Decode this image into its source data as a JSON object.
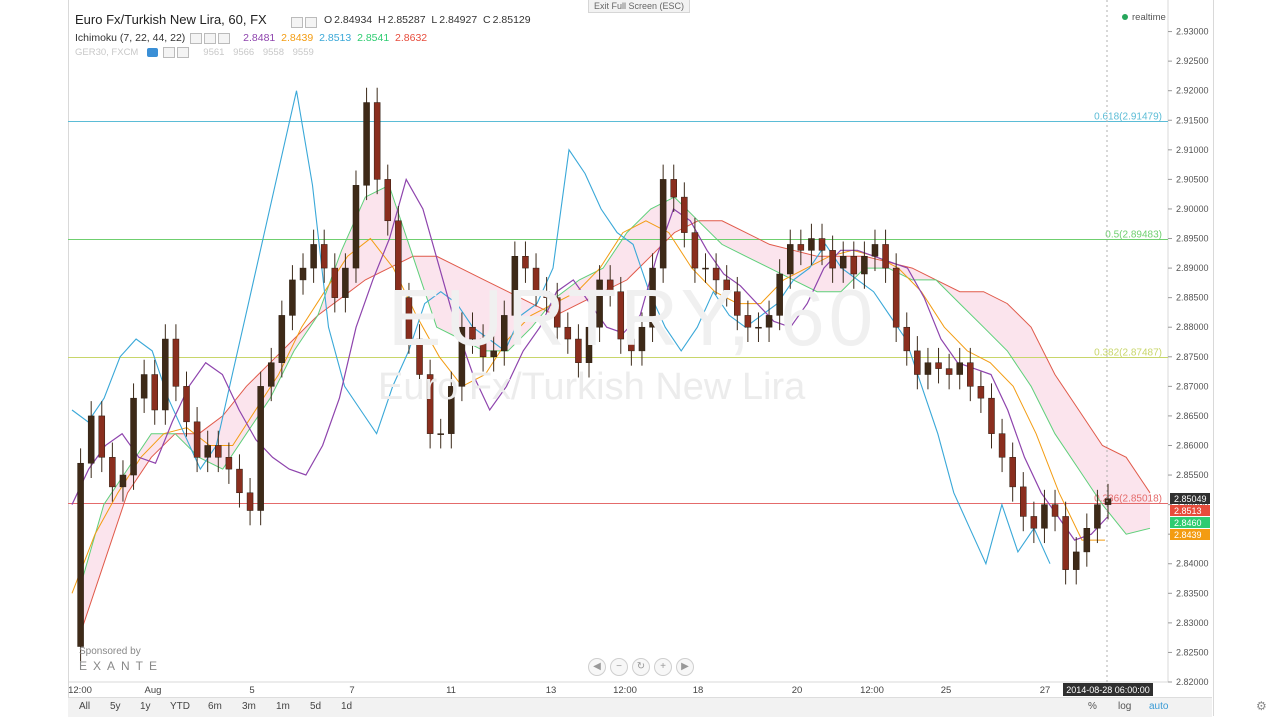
{
  "window": {
    "exit_fullscreen": "Exit Full Screen (ESC)",
    "realtime": "realtime"
  },
  "legend": {
    "symbol_title": "Euro Fx/Turkish New Lira, 60, FX",
    "ohlc": {
      "o_label": "O",
      "o": "2.84934",
      "h_label": "H",
      "h": "2.85287",
      "l_label": "L",
      "l": "2.84927",
      "c_label": "C",
      "c": "2.85129"
    },
    "ichimoku": {
      "label": "Ichimoku (7, 22, 44, 22)",
      "values": [
        "2.8481",
        "2.8439",
        "2.8513",
        "2.8541",
        "2.8632"
      ],
      "colors": [
        "#8e44ad",
        "#f39c12",
        "#3aa8d8",
        "#2ecc71",
        "#e74c3c"
      ]
    },
    "compare": {
      "label": "GER30, FXCM",
      "values": [
        "9561",
        "9566",
        "9558",
        "9559"
      ]
    }
  },
  "watermark": {
    "symbol": "EURTRY, 60",
    "description": "Euro Fx/Turkish New Lira"
  },
  "sponsor": {
    "label": "Sponsored by",
    "brand": "EXANTE"
  },
  "bottom": {
    "ranges": [
      "All",
      "5y",
      "1y",
      "YTD",
      "6m",
      "3m",
      "1m",
      "5d",
      "1d"
    ],
    "percent": "%",
    "log": "log",
    "auto": "auto"
  },
  "colors": {
    "tenkan": "#8e44ad",
    "kijun": "#f39c12",
    "chikou": "#3aa8d8",
    "span_a": "#5ed07a",
    "span_b": "#e05a4a",
    "cloud": "#f9d9e6",
    "candle_up": "#5a3a1a",
    "candle_down": "#7a2a1a"
  },
  "chart_data": {
    "type": "candlestick",
    "title": "Euro Fx/Turkish New Lira, 60, FX",
    "ylim": [
      2.82,
      2.935
    ],
    "y_ticks": [
      "2.93000",
      "2.92500",
      "2.92000",
      "2.91500",
      "2.91000",
      "2.90500",
      "2.90000",
      "2.89500",
      "2.89000",
      "2.88500",
      "2.88000",
      "2.87500",
      "2.87000",
      "2.86500",
      "2.86000",
      "2.85500",
      "2.85000",
      "2.84500",
      "2.84000",
      "2.83500",
      "2.83000",
      "2.82500",
      "2.82000"
    ],
    "x_tick_labels": [
      "12:00",
      "Aug",
      "5",
      "7",
      "11",
      "13",
      "12:00",
      "18",
      "20",
      "12:00",
      "25",
      "27",
      "2014-08-28 06:00:00"
    ],
    "fib_levels": [
      {
        "label": "0.618(2.91479)",
        "value": 2.91479,
        "color": "#5bbcd6"
      },
      {
        "label": "0.5(2.89483)",
        "value": 2.89483,
        "color": "#6fcf6f"
      },
      {
        "label": "0.382(2.87487)",
        "value": 2.87487,
        "color": "#c8d66a"
      },
      {
        "label": "0.236(2.85018)",
        "value": 2.85018,
        "color": "#e46b6b"
      }
    ],
    "price_labels": [
      {
        "value": "2.85049",
        "color": "#2f2f2f"
      },
      {
        "value": "2.8513",
        "color": "#e74c3c"
      },
      {
        "value": "2.8460",
        "color": "#2ecc71"
      },
      {
        "value": "2.8439",
        "color": "#f39c12"
      }
    ],
    "close_series": [
      2.826,
      2.857,
      2.865,
      2.858,
      2.853,
      2.855,
      2.868,
      2.872,
      2.866,
      2.878,
      2.87,
      2.864,
      2.858,
      2.86,
      2.858,
      2.856,
      2.852,
      2.849,
      2.87,
      2.874,
      2.882,
      2.888,
      2.89,
      2.894,
      2.89,
      2.885,
      2.89,
      2.904,
      2.918,
      2.905,
      2.898,
      2.885,
      2.878,
      2.872,
      2.862,
      2.862,
      2.87,
      2.88,
      2.878,
      2.875,
      2.876,
      2.882,
      2.892,
      2.89,
      2.886,
      2.885,
      2.88,
      2.878,
      2.874,
      2.88,
      2.888,
      2.886,
      2.878,
      2.876,
      2.88,
      2.89,
      2.905,
      2.902,
      2.896,
      2.89,
      2.89,
      2.888,
      2.886,
      2.882,
      2.88,
      2.88,
      2.882,
      2.889,
      2.894,
      2.893,
      2.895,
      2.893,
      2.89,
      2.892,
      2.889,
      2.892,
      2.894,
      2.89,
      2.88,
      2.876,
      2.872,
      2.874,
      2.873,
      2.872,
      2.874,
      2.87,
      2.868,
      2.862,
      2.858,
      2.853,
      2.848,
      2.846,
      2.85,
      2.848,
      2.839,
      2.842,
      2.846,
      2.85,
      2.851
    ],
    "chikou_series": [
      2.866,
      2.864,
      2.868,
      2.875,
      2.878,
      2.876,
      2.868,
      2.862,
      2.856,
      2.86,
      2.872,
      2.884,
      2.896,
      2.908,
      2.92,
      2.904,
      2.88,
      2.87,
      2.866,
      2.862,
      2.87,
      2.876,
      2.884,
      2.886,
      2.884,
      2.88,
      2.878,
      2.876,
      2.882,
      2.884,
      2.89,
      2.91,
      2.906,
      2.9,
      2.896,
      2.894,
      2.886,
      2.88,
      2.876,
      2.88,
      2.886,
      2.882,
      2.88,
      2.882,
      2.884,
      2.888,
      2.89,
      2.894,
      2.89,
      2.888,
      2.886,
      2.882,
      2.878,
      2.87,
      2.862,
      2.852,
      2.846,
      2.84,
      2.85,
      2.842,
      2.846,
      2.84
    ],
    "tenkan_series": [
      2.85,
      2.856,
      2.86,
      2.862,
      2.858,
      2.857,
      2.864,
      2.87,
      2.874,
      2.872,
      2.866,
      2.861,
      2.858,
      2.856,
      2.855,
      2.86,
      2.868,
      2.88,
      2.888,
      2.895,
      2.905,
      2.9,
      2.89,
      2.88,
      2.872,
      2.866,
      2.87,
      2.876,
      2.88,
      2.886,
      2.888,
      2.884,
      2.88,
      2.879,
      2.882,
      2.892,
      2.9,
      2.898,
      2.893,
      2.889,
      2.887,
      2.884,
      2.881,
      2.88,
      2.884,
      2.89,
      2.893,
      2.893,
      2.892,
      2.891,
      2.89,
      2.885,
      2.878,
      2.874,
      2.873,
      2.872,
      2.866,
      2.858,
      2.852,
      2.848,
      2.844,
      2.845,
      2.848
    ],
    "kijun_series": [
      2.835,
      2.845,
      2.852,
      2.858,
      2.862,
      2.863,
      2.86,
      2.86,
      2.866,
      2.872,
      2.88,
      2.886,
      2.892,
      2.895,
      2.89,
      2.882,
      2.875,
      2.87,
      2.872,
      2.878,
      2.882,
      2.884,
      2.886,
      2.89,
      2.896,
      2.898,
      2.896,
      2.89,
      2.886,
      2.884,
      2.884,
      2.888,
      2.89,
      2.892,
      2.893,
      2.892,
      2.89,
      2.886,
      2.88,
      2.876,
      2.874,
      2.87,
      2.862,
      2.852,
      2.844,
      2.844
    ],
    "span_a_series": [
      2.836,
      2.85,
      2.856,
      2.862,
      2.862,
      2.858,
      2.856,
      2.862,
      2.868,
      2.876,
      2.882,
      2.893,
      2.902,
      2.904,
      2.892,
      2.88,
      2.878,
      2.876,
      2.876,
      2.88,
      2.885,
      2.888,
      2.89,
      2.896,
      2.9,
      2.902,
      2.898,
      2.894,
      2.892,
      2.89,
      2.888,
      2.886,
      2.886,
      2.89,
      2.89,
      2.888,
      2.888,
      2.884,
      2.88,
      2.876,
      2.87,
      2.862,
      2.856,
      2.85,
      2.845,
      2.846
    ],
    "span_b_series": [
      2.828,
      2.84,
      2.852,
      2.858,
      2.862,
      2.862,
      2.865,
      2.87,
      2.874,
      2.878,
      2.882,
      2.885,
      2.888,
      2.89,
      2.892,
      2.892,
      2.89,
      2.888,
      2.886,
      2.884,
      2.882,
      2.884,
      2.886,
      2.888,
      2.892,
      2.896,
      2.898,
      2.898,
      2.896,
      2.894,
      2.893,
      2.892,
      2.892,
      2.892,
      2.891,
      2.89,
      2.888,
      2.886,
      2.886,
      2.884,
      2.88,
      2.872,
      2.866,
      2.86,
      2.858,
      2.852
    ],
    "last_price": 2.85129
  }
}
